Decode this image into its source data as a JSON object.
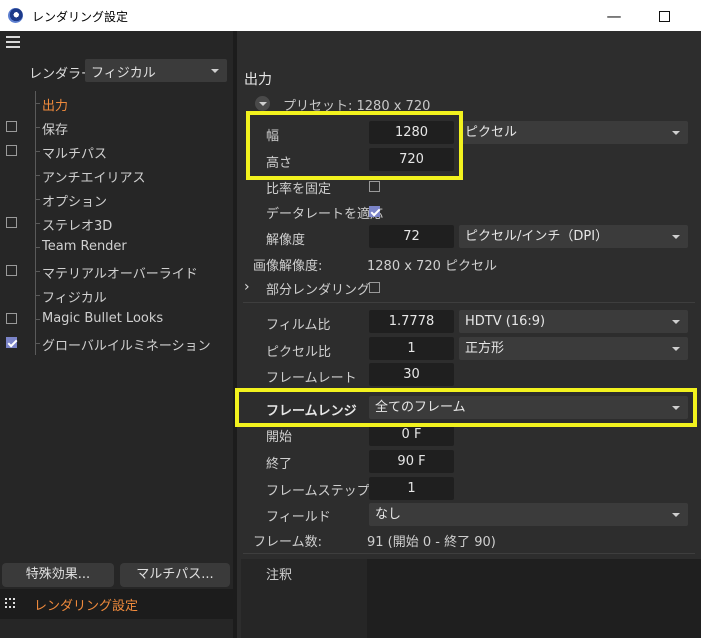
{
  "window": {
    "title": "レンダリング設定",
    "minimize_glyph": "—",
    "maximize_glyph": ""
  },
  "left": {
    "renderer_label": "レンダラー",
    "renderer_value": "フィジカル",
    "nav_items": [
      {
        "label": "出力",
        "checkbox": "none",
        "active": true
      },
      {
        "label": "保存",
        "checkbox": "unchecked",
        "active": false
      },
      {
        "label": "マルチパス",
        "checkbox": "unchecked",
        "active": false
      },
      {
        "label": "アンチエイリアス",
        "checkbox": "none",
        "active": false
      },
      {
        "label": "オプション",
        "checkbox": "none",
        "active": false
      },
      {
        "label": "ステレオ3D",
        "checkbox": "unchecked",
        "active": false
      },
      {
        "label": "Team Render",
        "checkbox": "none",
        "active": false
      },
      {
        "label": "マテリアルオーバーライド",
        "checkbox": "unchecked",
        "active": false
      },
      {
        "label": "フィジカル",
        "checkbox": "none",
        "active": false
      },
      {
        "label": "Magic Bullet Looks",
        "checkbox": "unchecked",
        "active": false
      },
      {
        "label": "グローバルイルミネーション",
        "checkbox": "checked",
        "active": false
      }
    ],
    "effects_button": "特殊効果...",
    "multipass_button": "マルチパス...",
    "footer_label": "レンダリング設定"
  },
  "output": {
    "section_title": "出力",
    "preset": "プリセット: 1280 x 720",
    "width_label": "幅",
    "width_value": "1280",
    "height_label": "高さ",
    "height_value": "720",
    "size_unit": "ピクセル",
    "lock_ratio_label": "比率を固定",
    "lock_ratio_checked": false,
    "adapt_framerate_label": "データレートを適応",
    "adapt_framerate_checked": true,
    "resolution_label": "解像度",
    "resolution_value": "72",
    "resolution_unit": "ピクセル/インチ（DPI）",
    "image_resolution_label": "画像解像度:",
    "image_resolution_value": "1280 x 720 ピクセル",
    "region_render_label": "部分レンダリング",
    "region_render_checked": false,
    "film_aspect_label": "フィルム比",
    "film_aspect_value": "1.7778",
    "film_aspect_preset": "HDTV (16:9)",
    "pixel_aspect_label": "ピクセル比",
    "pixel_aspect_value": "1",
    "pixel_aspect_preset": "正方形",
    "framerate_label": "フレームレート",
    "framerate_value": "30",
    "frame_range_label": "フレームレンジ",
    "frame_range_value": "全てのフレーム",
    "start_label": "開始",
    "start_value": "0 F",
    "end_label": "終了",
    "end_value": "90 F",
    "frame_step_label": "フレームステップ",
    "frame_step_value": "1",
    "field_label": "フィールド",
    "field_value": "なし",
    "frame_count_label": "フレーム数:",
    "frame_count_value": "91 (開始 0 - 終了 90)",
    "notes_label": "注釈"
  },
  "colors": {
    "accent_orange": "#f08a3c",
    "highlight_yellow": "#f2f21e",
    "checkbox_blue": "#7b84c8"
  }
}
